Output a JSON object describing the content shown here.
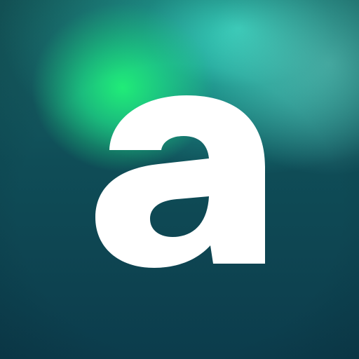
{
  "app_icon": {
    "logo_icon": "lowercase-a-logo-icon",
    "colors": {
      "letter": "#ffffff",
      "background_dark": "#0c3c4c",
      "background_mid": "#0f4d57",
      "glow_green": "#20ec78",
      "glow_cyan": "#40e8d0"
    }
  }
}
